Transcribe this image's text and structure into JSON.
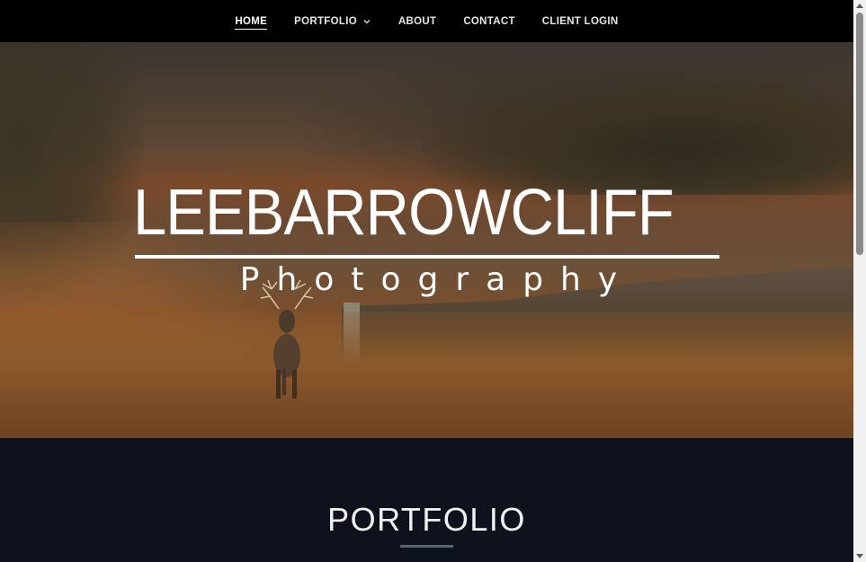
{
  "nav": {
    "items": [
      {
        "label": "HOME",
        "active": true
      },
      {
        "label": "PORTFOLIO",
        "has_dropdown": true
      },
      {
        "label": "ABOUT"
      },
      {
        "label": "CONTACT"
      },
      {
        "label": "CLIENT LOGIN"
      }
    ]
  },
  "hero": {
    "logo_name": "LEEBARROWCLIFF",
    "logo_sub": "Photography"
  },
  "portfolio": {
    "title": "PORTFOLIO"
  },
  "icons": {
    "dropdown": "chevron-down-icon"
  },
  "colors": {
    "nav_bg": "#000000",
    "section_bg": "#0e121c",
    "accent_rule": "#5a6170"
  }
}
